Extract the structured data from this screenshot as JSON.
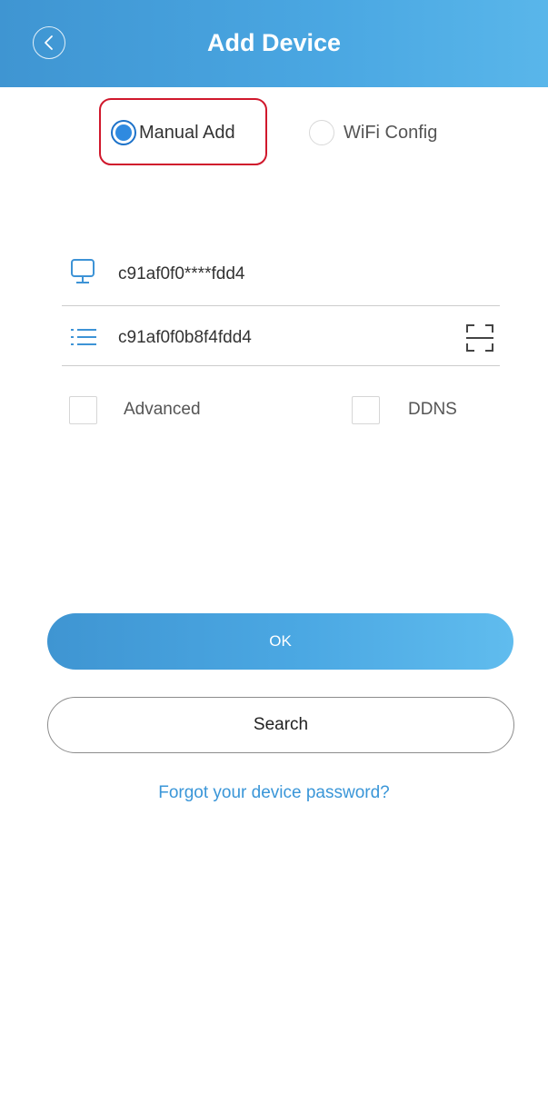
{
  "header": {
    "title": "Add Device",
    "back_icon": "chevron-left-icon",
    "background_color": "#4aa7e2"
  },
  "mode_selector": {
    "options": [
      {
        "label": "Manual Add",
        "selected": true
      },
      {
        "label": "WiFi Config",
        "selected": false
      }
    ],
    "highlight_color": "#d0182c"
  },
  "fields": {
    "device_id": {
      "value": "c91af0f0****fdd4",
      "icon": "monitor-icon"
    },
    "serial": {
      "value": "c91af0f0b8f4fdd4",
      "icon": "list-icon",
      "action_icon": "qr-scan-icon"
    }
  },
  "options": {
    "advanced": {
      "label": "Advanced",
      "checked": false
    },
    "ddns": {
      "label": "DDNS",
      "checked": false
    }
  },
  "actions": {
    "ok_label": "OK",
    "search_label": "Search",
    "forgot_password_label": "Forgot your device password?"
  },
  "colors": {
    "accent": "#3a96d8",
    "radio_selected": "#2f8ae0"
  }
}
